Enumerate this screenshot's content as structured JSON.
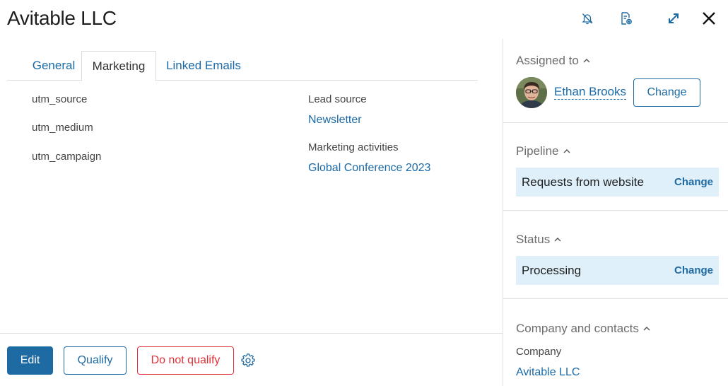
{
  "header": {
    "title": "Avitable LLC"
  },
  "toolbar_icons": [
    "bell-off-icon",
    "document-settings-icon",
    "expand-icon",
    "close-icon"
  ],
  "tabs": [
    {
      "label": "General",
      "active": false
    },
    {
      "label": "Marketing",
      "active": true
    },
    {
      "label": "Linked Emails",
      "active": false
    }
  ],
  "marketing": {
    "utm_source_label": "utm_source",
    "utm_medium_label": "utm_medium",
    "utm_campaign_label": "utm_campaign",
    "lead_source_label": "Lead source",
    "lead_source_value": "Newsletter",
    "activities_label": "Marketing activities",
    "activities_value": "Global Conference 2023"
  },
  "footer": {
    "edit_label": "Edit",
    "qualify_label": "Qualify",
    "do_not_qualify_label": "Do not qualify"
  },
  "sidebar": {
    "assigned": {
      "heading": "Assigned to",
      "user": "Ethan Brooks",
      "change_label": "Change"
    },
    "pipeline": {
      "heading": "Pipeline",
      "value": "Requests from website",
      "change_label": "Change"
    },
    "status": {
      "heading": "Status",
      "value": "Processing",
      "change_label": "Change"
    },
    "company": {
      "heading": "Company and contacts",
      "company_label": "Company",
      "company_value": "Avitable LLC"
    }
  },
  "colors": {
    "accent": "#1e6aa3",
    "danger": "#e0313a",
    "highlight": "#dff0fa"
  }
}
